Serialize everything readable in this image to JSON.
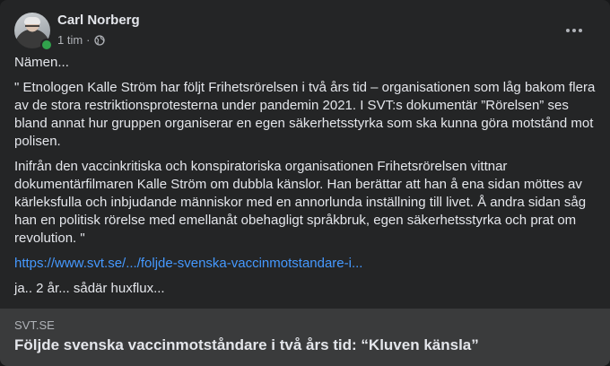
{
  "post": {
    "author": "Carl Norberg",
    "timestamp": "1 tim",
    "separator": "·",
    "privacy_icon": "globe-icon",
    "more_icon": "more-options-icon",
    "paragraphs": [
      "Nämen...",
      "\" Etnologen Kalle Ström har följt Frihetsrörelsen i två års tid – organisationen som låg bakom flera av de stora restriktionsprotesterna under pandemin 2021. I SVT:s dokumentär ”Rörelsen” ses bland annat hur gruppen organiserar en egen säkerhetsstyrka som ska kunna göra motstånd mot polisen.",
      "Inifrån den vaccinkritiska och konspiratoriska organisationen Frihetsrörelsen vittnar dokumentärfilmaren Kalle Ström om dubbla känslor. Han berättar att han å ena sidan möttes av kärleksfulla och inbjudande människor med en annorlunda inställning till livet. Å andra sidan såg han en politisk rörelse med emellanåt obehagligt språkbruk, egen säkerhetsstyrka och prat om revolution.  \""
    ],
    "link_text": "https://www.svt.se/.../foljde-svenska-vaccinmotstandare-i...",
    "closing": "ja.. 2 år... sådär huxflux..."
  },
  "preview": {
    "domain": "SVT.SE",
    "title": "Följde svenska vaccinmotståndare i två års tid: “Kluven känsla”"
  },
  "colors": {
    "background": "#242526",
    "text": "#e4e6eb",
    "secondary_text": "#b0b3b8",
    "link": "#4599ff",
    "online": "#31a24c",
    "preview_bg": "#3a3b3c"
  }
}
